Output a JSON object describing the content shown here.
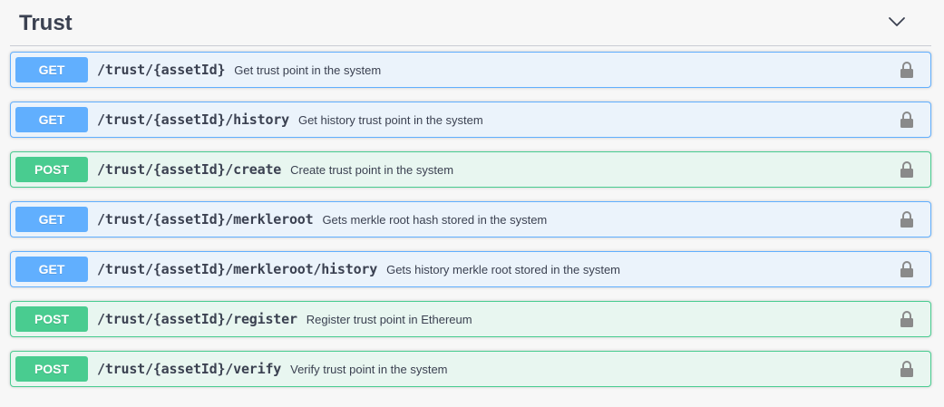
{
  "section": {
    "title": "Trust",
    "chevron_icon": "chevron-down-icon"
  },
  "colors": {
    "get": "#61affe",
    "post": "#49cc90",
    "get_bg": "#ebf3fb",
    "post_bg": "#e8f6f0"
  },
  "operations": [
    {
      "method": "GET",
      "path": "/trust/{assetId}",
      "summary": "Get trust point in the system",
      "icon": "lock-icon"
    },
    {
      "method": "GET",
      "path": "/trust/{assetId}/history",
      "summary": "Get history trust point in the system",
      "icon": "lock-icon"
    },
    {
      "method": "POST",
      "path": "/trust/{assetId}/create",
      "summary": "Create trust point in the system",
      "icon": "lock-icon"
    },
    {
      "method": "GET",
      "path": "/trust/{assetId}/merkleroot",
      "summary": "Gets merkle root hash stored in the system",
      "icon": "lock-icon"
    },
    {
      "method": "GET",
      "path": "/trust/{assetId}/merkleroot/history",
      "summary": "Gets history merkle root stored in the system",
      "icon": "lock-icon"
    },
    {
      "method": "POST",
      "path": "/trust/{assetId}/register",
      "summary": "Register trust point in Ethereum",
      "icon": "lock-icon"
    },
    {
      "method": "POST",
      "path": "/trust/{assetId}/verify",
      "summary": "Verify trust point in the system",
      "icon": "lock-icon"
    }
  ]
}
